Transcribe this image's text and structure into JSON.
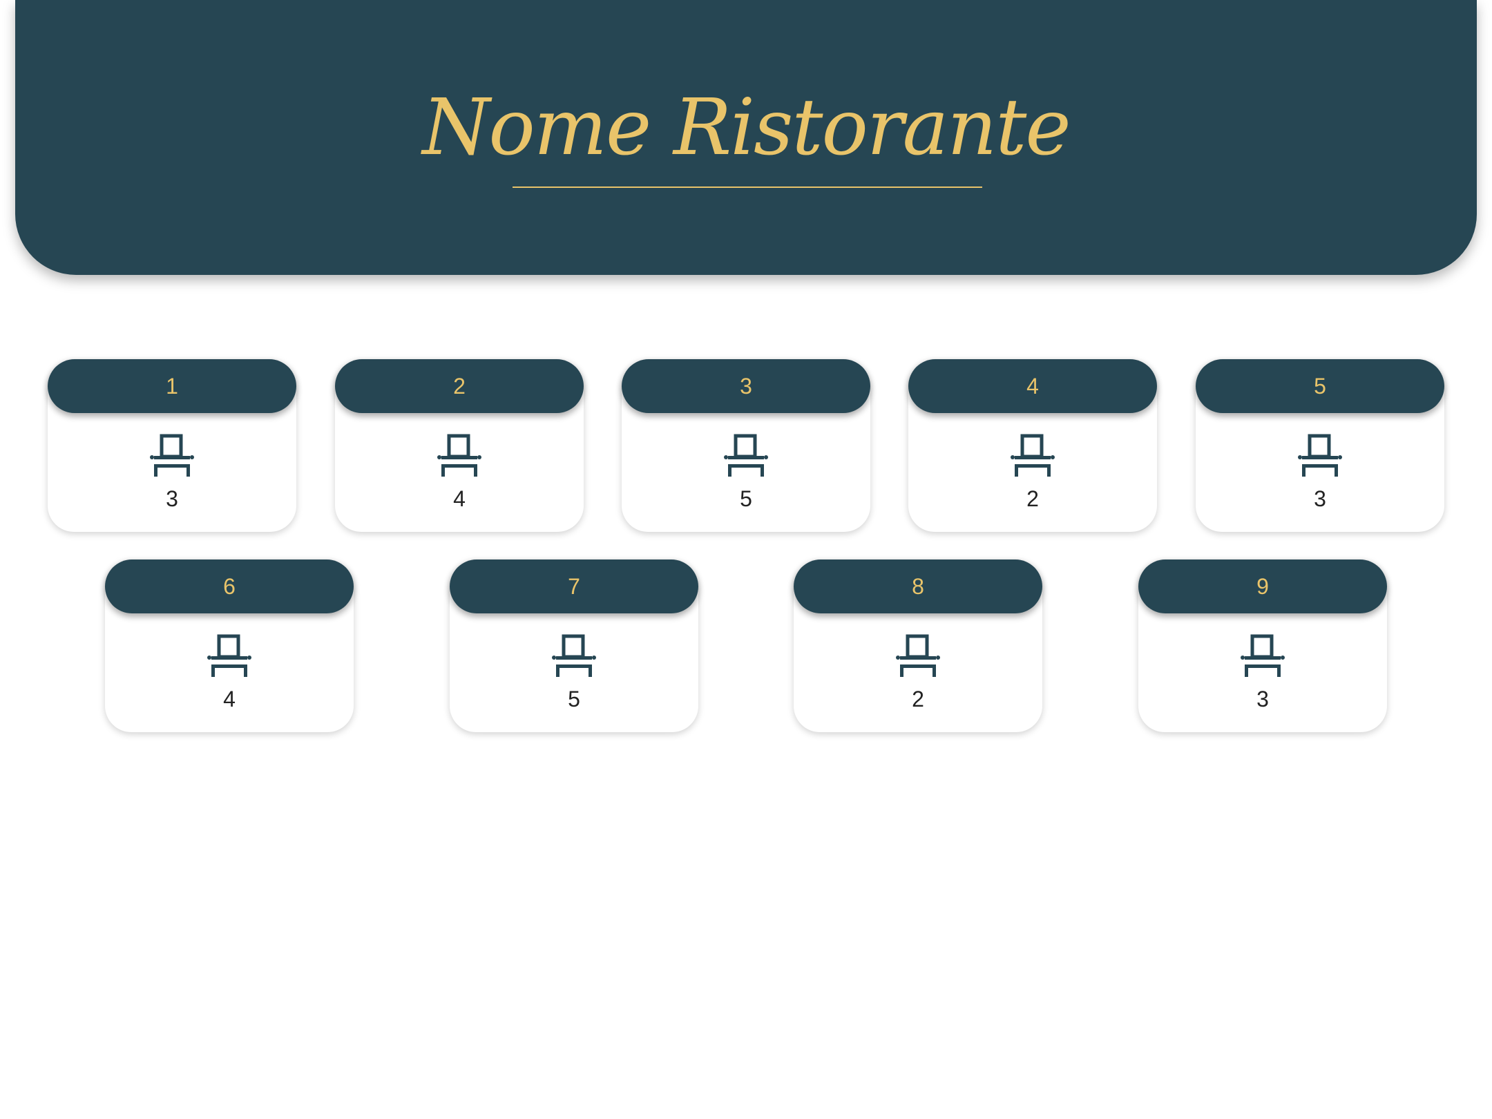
{
  "header": {
    "title": "Nome Ristorante"
  },
  "tables": [
    {
      "number": "1",
      "seats": "3"
    },
    {
      "number": "2",
      "seats": "4"
    },
    {
      "number": "3",
      "seats": "5"
    },
    {
      "number": "4",
      "seats": "2"
    },
    {
      "number": "5",
      "seats": "3"
    },
    {
      "number": "6",
      "seats": "4"
    },
    {
      "number": "7",
      "seats": "5"
    },
    {
      "number": "8",
      "seats": "2"
    },
    {
      "number": "9",
      "seats": "3"
    }
  ],
  "icons": {
    "seat": "chair-icon"
  },
  "colors": {
    "primary": "#264653",
    "accent": "#e9c46a"
  }
}
